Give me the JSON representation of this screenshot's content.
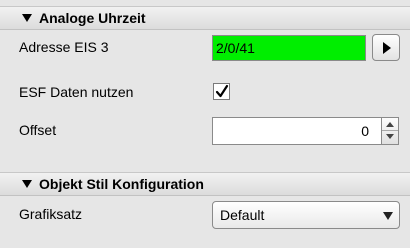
{
  "sections": {
    "analog_clock": {
      "title": "Analoge Uhrzeit",
      "address": {
        "label": "Adresse EIS 3",
        "value": "2/0/41"
      },
      "esf": {
        "label": "ESF Daten nutzen",
        "checked": true
      },
      "offset": {
        "label": "Offset",
        "value": "0"
      }
    },
    "object_style": {
      "title": "Objekt Stil Konfiguration",
      "graphics_set": {
        "label": "Grafiksatz",
        "value": "Default"
      }
    }
  },
  "colors": {
    "address_field_bg": "#00ee00"
  },
  "icons": {
    "collapse": "triangle-down-icon",
    "address_button": "play-arrow-icon",
    "checkbox": "checkmark-icon",
    "spinner_up": "arrow-up-icon",
    "spinner_down": "arrow-down-icon",
    "dropdown": "chevron-down-icon"
  }
}
